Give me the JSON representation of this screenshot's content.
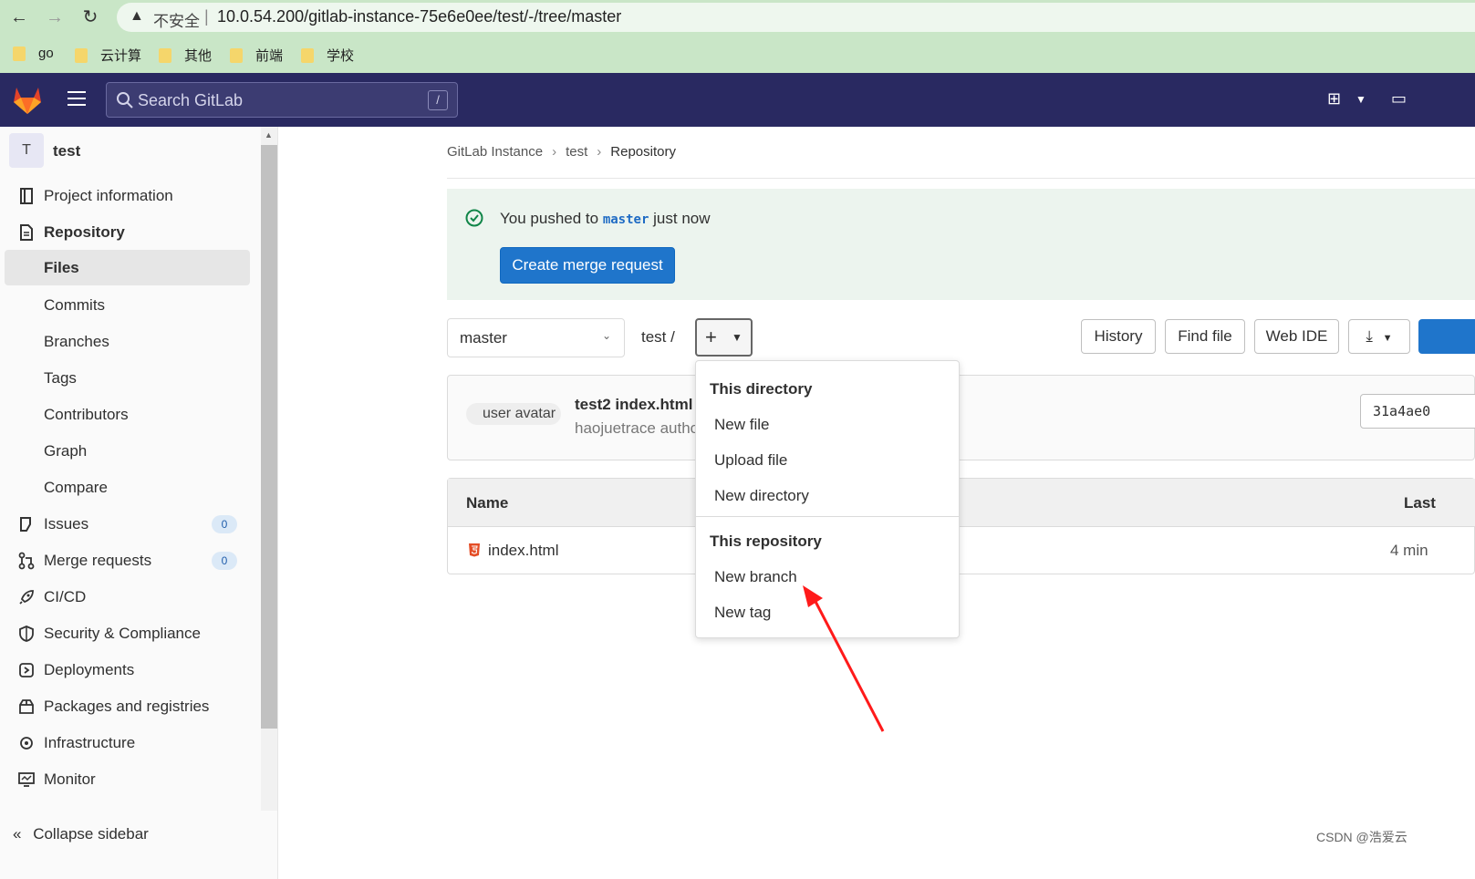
{
  "browser": {
    "insecure_label": "不安全",
    "url": "10.0.54.200/gitlab-instance-75e6e0ee/test/-/tree/master",
    "bookmarks": [
      "go",
      "云计算",
      "其他",
      "前端",
      "学校"
    ]
  },
  "topbar": {
    "search_placeholder": "Search GitLab",
    "search_shortcut": "/"
  },
  "sidebar": {
    "project_initial": "T",
    "project_name": "test",
    "items": [
      {
        "label": "Project information"
      },
      {
        "label": "Repository"
      },
      {
        "label": "Files"
      },
      {
        "label": "Commits"
      },
      {
        "label": "Branches"
      },
      {
        "label": "Tags"
      },
      {
        "label": "Contributors"
      },
      {
        "label": "Graph"
      },
      {
        "label": "Compare"
      },
      {
        "label": "Issues",
        "badge": "0"
      },
      {
        "label": "Merge requests",
        "badge": "0"
      },
      {
        "label": "CI/CD"
      },
      {
        "label": "Security & Compliance"
      },
      {
        "label": "Deployments"
      },
      {
        "label": "Packages and registries"
      },
      {
        "label": "Infrastructure"
      },
      {
        "label": "Monitor"
      }
    ],
    "collapse_label": "Collapse sidebar"
  },
  "breadcrumb": [
    "GitLab Instance",
    "test",
    "Repository"
  ],
  "alert": {
    "prefix": "You pushed to",
    "branch": "master",
    "suffix": "just now",
    "button": "Create merge request"
  },
  "toolbar": {
    "branch": "master",
    "path": "test  /",
    "plus": "+",
    "history": "History",
    "find_file": "Find file",
    "web_ide": "Web IDE"
  },
  "commit": {
    "avatar_alt": "user avatar",
    "title": "test2 index.html",
    "author": "haojuetrace authored",
    "sha": "31a4ae0"
  },
  "table": {
    "col_name": "Name",
    "col_last": "Last",
    "rows": [
      {
        "name": "index.html",
        "time": "4 min"
      }
    ]
  },
  "dropdown": {
    "dir_header": "This directory",
    "dir_items": [
      "New file",
      "Upload file",
      "New directory"
    ],
    "repo_header": "This repository",
    "repo_items": [
      "New branch",
      "New tag"
    ]
  },
  "colors": {
    "topbar": "#292961",
    "primary": "#1f75cb",
    "alert_bg": "#ecf4ee",
    "annotation_arrow": "#ff1a1a"
  },
  "watermark": "CSDN @浩爱云"
}
